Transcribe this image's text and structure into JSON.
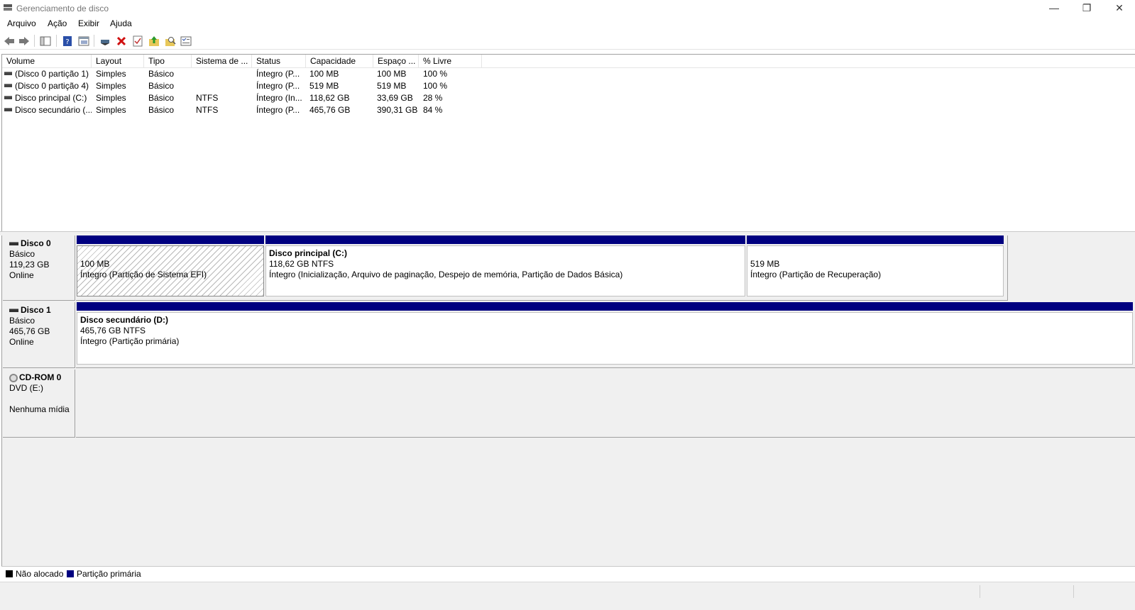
{
  "window": {
    "title": "Gerenciamento de disco",
    "minimize_label": "—",
    "maximize_label": "❐",
    "close_label": "✕"
  },
  "menu": [
    "Arquivo",
    "Ação",
    "Exibir",
    "Ajuda"
  ],
  "toolbar": {
    "icons": [
      "back-icon",
      "forward-icon",
      "console-tree-icon",
      "help-icon",
      "properties-view-icon",
      "connect-drive-icon",
      "delete-icon",
      "check-icon",
      "folder-up-icon",
      "folder-search-icon",
      "properties-icon"
    ]
  },
  "volume_list": {
    "columns": [
      "Volume",
      "Layout",
      "Tipo",
      "Sistema de ...",
      "Status",
      "Capacidade",
      "Espaço ...",
      "% Livre"
    ],
    "rows": [
      [
        "(Disco 0 partição 1)",
        "Simples",
        "Básico",
        "",
        "Íntegro (P...",
        "100 MB",
        "100 MB",
        "100 %"
      ],
      [
        "(Disco 0 partição 4)",
        "Simples",
        "Básico",
        "",
        "Íntegro (P...",
        "519 MB",
        "519 MB",
        "100 %"
      ],
      [
        "Disco principal (C:)",
        "Simples",
        "Básico",
        "NTFS",
        "Íntegro (In...",
        "118,62 GB",
        "33,69 GB",
        "28 %"
      ],
      [
        "Disco secundário (...",
        "Simples",
        "Básico",
        "NTFS",
        "Íntegro (P...",
        "465,76 GB",
        "390,31 GB",
        "84 %"
      ]
    ]
  },
  "disks": [
    {
      "name": "Disco 0",
      "type": "Básico",
      "size": "119,23 GB",
      "state": "Online",
      "partitions": [
        {
          "title": "",
          "line1": "100 MB",
          "line2": "Íntegro (Partição de Sistema EFI)",
          "hatched": true
        },
        {
          "title": "Disco principal  (C:)",
          "line1": "118,62 GB NTFS",
          "line2": "Íntegro (Inicialização, Arquivo de paginação, Despejo de memória, Partição de Dados Básica)"
        },
        {
          "title": "",
          "line1": "519 MB",
          "line2": "Íntegro (Partição de Recuperação)"
        }
      ]
    },
    {
      "name": "Disco 1",
      "type": "Básico",
      "size": "465,76 GB",
      "state": "Online",
      "partitions": [
        {
          "title": "Disco secundário  (D:)",
          "line1": "465,76 GB NTFS",
          "line2": "Íntegro (Partição primária)"
        }
      ]
    },
    {
      "name": "CD-ROM 0",
      "type": "DVD (E:)",
      "size": "",
      "state": "Nenhuma mídia"
    }
  ],
  "legend": [
    {
      "label": "Não alocado",
      "color": "#000000"
    },
    {
      "label": "Partição primária",
      "color": "#000080"
    }
  ]
}
